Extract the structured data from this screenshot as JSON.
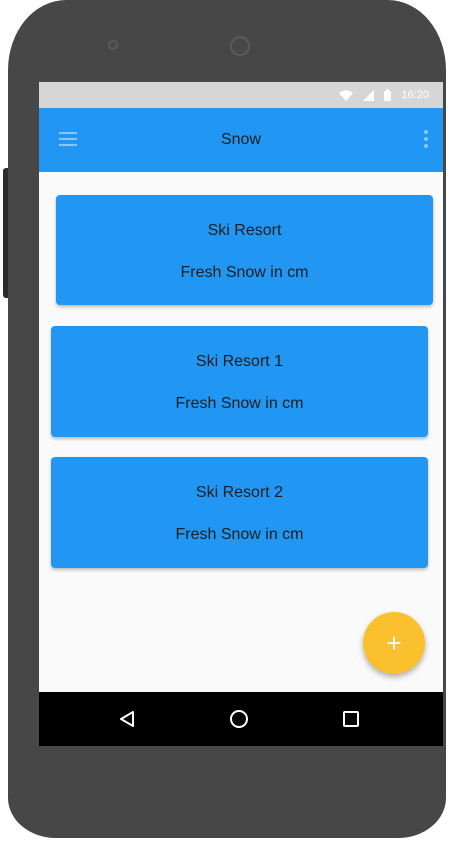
{
  "status_bar": {
    "time": "16:20",
    "icons": [
      "wifi-icon",
      "signal-icon",
      "battery-icon"
    ]
  },
  "app_bar": {
    "title": "Snow",
    "menu_icon": "hamburger-menu-icon",
    "overflow_icon": "overflow-menu-icon"
  },
  "cards": [
    {
      "title": "Ski Resort",
      "subtitle": "Fresh Snow in cm"
    },
    {
      "title": "Ski Resort 1",
      "subtitle": "Fresh Snow in cm"
    },
    {
      "title": "Ski Resort 2",
      "subtitle": "Fresh Snow in cm"
    }
  ],
  "fab": {
    "label": "+",
    "icon": "add-icon"
  },
  "nav_bar": {
    "buttons": [
      "back-icon",
      "home-icon",
      "recent-apps-icon"
    ]
  },
  "colors": {
    "primary": "#2196f3",
    "accent": "#fbc02d",
    "device": "#474747",
    "status_bar": "#d6d6d6",
    "nav_bar": "#000000"
  }
}
